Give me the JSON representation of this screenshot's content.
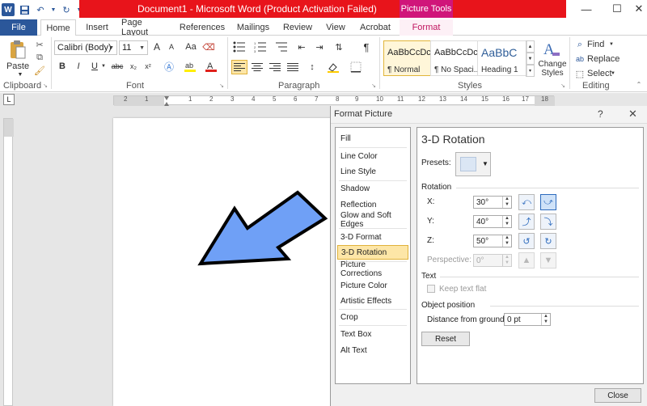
{
  "window": {
    "title": "Document1  -  Microsoft Word (Product Activation Failed)",
    "context_tab_group": "Picture Tools",
    "minimize": "—",
    "restore": "☐",
    "close": "✕"
  },
  "tabs": [
    "File",
    "Home",
    "Insert",
    "Page Layout",
    "References",
    "Mailings",
    "Review",
    "View",
    "Acrobat",
    "Format"
  ],
  "ribbon": {
    "clipboard": {
      "paste_label": "Paste",
      "group": "Clipboard"
    },
    "font": {
      "name": "Calibri (Body)",
      "size": "11",
      "group": "Font",
      "bold": "B",
      "italic": "I",
      "underline": "U",
      "strike": "abc",
      "sub": "x₂",
      "sup": "x²",
      "grow": "A",
      "shrink": "A",
      "case": "Aa",
      "clear": "A"
    },
    "paragraph": {
      "group": "Paragraph",
      "pilcrow": "¶"
    },
    "styles": {
      "group": "Styles",
      "items": [
        {
          "sample": "AaBbCcDc",
          "name": "¶ Normal"
        },
        {
          "sample": "AaBbCcDc",
          "name": "¶ No Spaci..."
        },
        {
          "sample": "AaBbC",
          "name": "Heading 1"
        }
      ],
      "change_styles": "Change Styles"
    },
    "editing": {
      "group": "Editing",
      "find": "Find",
      "replace": "Replace",
      "select": "Select"
    }
  },
  "ruler": {
    "tab_marker": "L",
    "numbers": [
      "2",
      "1",
      "1",
      "2",
      "3",
      "4",
      "5",
      "6",
      "7",
      "8",
      "9",
      "10",
      "11",
      "12",
      "13",
      "14",
      "15",
      "16",
      "17",
      "18"
    ]
  },
  "pane": {
    "title": "Format Picture",
    "help": "?",
    "close": "✕",
    "categories": [
      "Fill",
      "Line Color",
      "Line Style",
      "Shadow",
      "Reflection",
      "Glow and Soft Edges",
      "3-D Format",
      "3-D Rotation",
      "Picture Corrections",
      "Picture Color",
      "Artistic Effects",
      "Crop",
      "Text Box",
      "Alt Text"
    ],
    "selected_category": "3-D Rotation",
    "heading": "3-D Rotation",
    "presets_label": "Presets:",
    "rotation_section": "Rotation",
    "x_label": "X:",
    "x_value": "30°",
    "y_label": "Y:",
    "y_value": "40°",
    "z_label": "Z:",
    "z_value": "50°",
    "perspective_label": "Perspective:",
    "perspective_value": "0°",
    "text_section": "Text",
    "keep_text_flat": "Keep text flat",
    "object_position_section": "Object position",
    "distance_label": "Distance from ground:",
    "distance_value": "0 pt",
    "reset_label": "Reset",
    "close_label": "Close"
  },
  "colors": {
    "accent": "#2b579a",
    "title_bar": "#e8141b",
    "picture_tools": "#d0157a",
    "arrow_fill": "#6fa0f6"
  }
}
